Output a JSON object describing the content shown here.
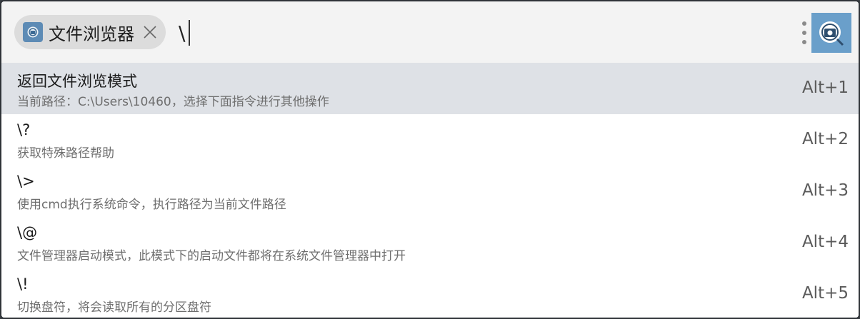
{
  "search": {
    "plugin_name": "文件浏览器",
    "query": "\\"
  },
  "icons": {
    "plugin": "file-browser-icon",
    "close": "close-icon",
    "more": "more-vertical-icon",
    "logo": "app-logo-icon"
  },
  "colors": {
    "selected_row": "#dee1e6",
    "search_bar": "#f3f3f3",
    "plugin_tag": "#dcdcdc",
    "plugin_icon": "#5d8bb5",
    "app_logo": "#6a9fca"
  },
  "results": [
    {
      "title": "返回文件浏览模式",
      "desc": "当前路径：C:\\Users\\10460，选择下面指令进行其他操作",
      "shortcut": "Alt+1",
      "selected": true
    },
    {
      "title": "\\?",
      "desc": "获取特殊路径帮助",
      "shortcut": "Alt+2",
      "selected": false
    },
    {
      "title": "\\>",
      "desc": "使用cmd执行系统命令，执行路径为当前文件路径",
      "shortcut": "Alt+3",
      "selected": false
    },
    {
      "title": "\\@",
      "desc": "文件管理器启动模式，此模式下的启动文件都将在系统文件管理器中打开",
      "shortcut": "Alt+4",
      "selected": false
    },
    {
      "title": "\\!",
      "desc": "切换盘符，将会读取所有的分区盘符",
      "shortcut": "Alt+5",
      "selected": false
    }
  ]
}
